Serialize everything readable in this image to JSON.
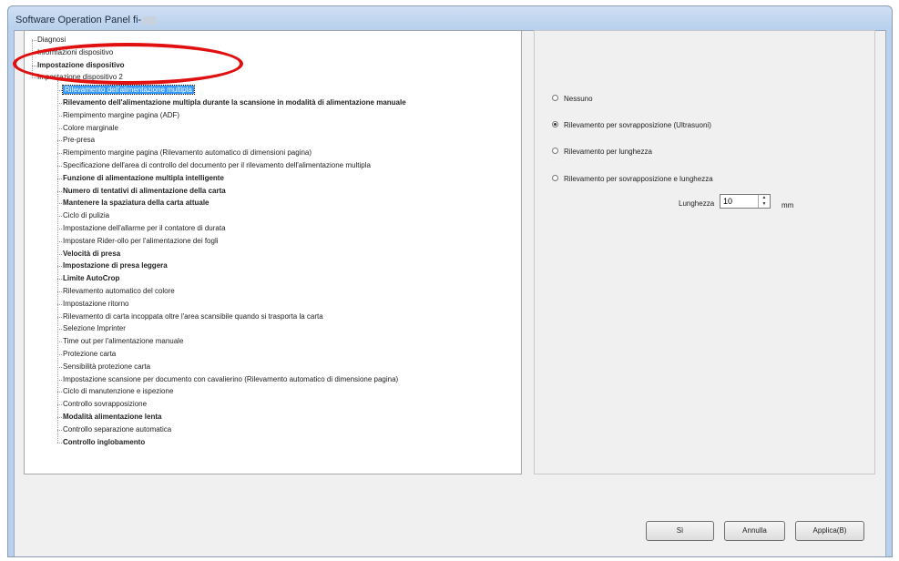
{
  "window": {
    "title": "Software Operation Panel fi-"
  },
  "tree": {
    "roots": [
      {
        "label": "Diagnosi",
        "bold": false
      },
      {
        "label": "Informazioni dispositivo",
        "bold": false
      },
      {
        "label": "Impostazione dispositivo",
        "bold": true
      },
      {
        "label": "Impostazione dispositivo 2",
        "bold": false
      }
    ],
    "children": [
      {
        "label": "Rilevamento dell'alimentazione multipla",
        "bold": false,
        "selected": true
      },
      {
        "label": "Rilevamento dell'alimentazione multipla durante la scansione in modalità di alimentazione manuale",
        "bold": true
      },
      {
        "label": "Riempimento margine pagina (ADF)",
        "bold": false
      },
      {
        "label": "Colore marginale",
        "bold": false
      },
      {
        "label": "Pre-presa",
        "bold": false
      },
      {
        "label": "Riempimento margine pagina (Rilevamento automatico di dimensioni pagina)",
        "bold": false
      },
      {
        "label": "Specificazione dell'area di controllo del documento per il rilevamento dell'alimentazione multipla",
        "bold": false
      },
      {
        "label": "Funzione di alimentazione multipla intelligente",
        "bold": true
      },
      {
        "label": "Numero di tentativi di alimentazione della carta",
        "bold": true
      },
      {
        "label": "Mantenere la spaziatura della carta attuale",
        "bold": true
      },
      {
        "label": "Ciclo di pulizia",
        "bold": false
      },
      {
        "label": "Impostazione dell'allarme per il contatore di durata",
        "bold": false
      },
      {
        "label": "Impostare Rider-ollo per l'alimentazione dei fogli",
        "bold": false
      },
      {
        "label": "Velocità di presa",
        "bold": true
      },
      {
        "label": "Impostazione di presa leggera",
        "bold": true
      },
      {
        "label": "Limite AutoCrop",
        "bold": true
      },
      {
        "label": "Rilevamento automatico del colore",
        "bold": false
      },
      {
        "label": "Impostazione ritorno",
        "bold": false
      },
      {
        "label": "Rilevamento di carta incoppata oltre l'area scansibile quando si trasporta la carta",
        "bold": false
      },
      {
        "label": "Selezione Imprinter",
        "bold": false
      },
      {
        "label": "Time out per l'alimentazione manuale",
        "bold": false
      },
      {
        "label": "Protezione carta",
        "bold": false
      },
      {
        "label": "Sensibilità protezione carta",
        "bold": false
      },
      {
        "label": "Impostazione scansione per documento con cavalierino (Rilevamento automatico di dimensione pagina)",
        "bold": false
      },
      {
        "label": "Ciclo di manutenzione e ispezione",
        "bold": false
      },
      {
        "label": "Controllo sovrapposizione",
        "bold": false
      },
      {
        "label": "Modalità alimentazione lenta",
        "bold": true
      },
      {
        "label": "Controllo separazione automatica",
        "bold": false
      },
      {
        "label": "Controllo inglobamento",
        "bold": true
      }
    ]
  },
  "options": [
    {
      "label": "Nessuno",
      "checked": false
    },
    {
      "label": "Rilevamento per sovrapposizione (Ultrasuoni)",
      "checked": true
    },
    {
      "label": "Rilevamento per lunghezza",
      "checked": false
    },
    {
      "label": "Rilevamento per sovrapposizione e lunghezza",
      "checked": false
    }
  ],
  "length": {
    "label": "Lunghezza",
    "value": "10",
    "unit": "mm"
  },
  "buttons": {
    "ok": "Sì",
    "cancel": "Annulla",
    "apply": "Applica(B)"
  }
}
